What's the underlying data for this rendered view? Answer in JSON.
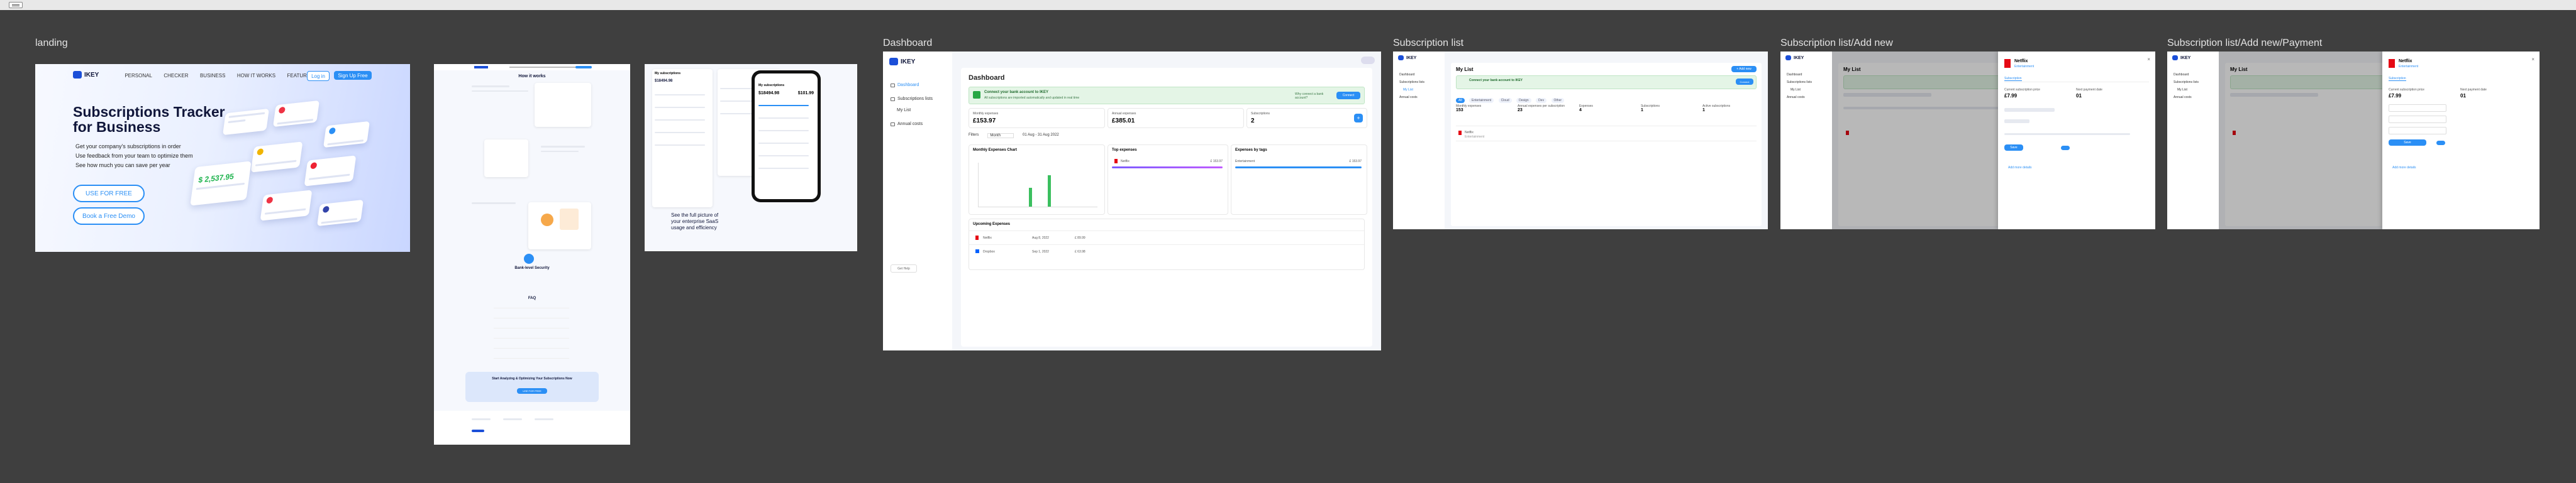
{
  "frames": {
    "landing": "landing",
    "dashboard": "Dashboard",
    "sub_list": "Subscription list",
    "sub_add": "Subscription list/Add new",
    "sub_add_payment": "Subscription list/Add new/Payment"
  },
  "landing": {
    "logo": "IKEY",
    "nav": [
      "PERSONAL",
      "CHECKER",
      "BUSINESS",
      "HOW IT WORKS",
      "FEATURES"
    ],
    "login": "Log in",
    "signup": "Sign Up Free",
    "title_line1": "Subscriptions Tracker",
    "title_line2": "for Business",
    "bullets": [
      "Get your company's subscriptions in order",
      "Use feedback from your team to optimize them",
      "See how much you can save per year"
    ],
    "cta_primary": "USE FOR FREE",
    "cta_secondary": "Book a Free Demo",
    "card_amount": "$ 2,537.95",
    "long_heading": "How it works",
    "long_security": "Bank-level Security",
    "long_faq": "FAQ",
    "long_cta": "Start Analyzing & Optimizing Your Subscriptions Now",
    "phone_title": "My subscriptions",
    "phone_amount_a": "$18494.98",
    "phone_amount_b": "$101.99",
    "phone_caption": "See the full picture of your enterprise SaaS usage and efficiency"
  },
  "dashboard": {
    "logo": "IKEY",
    "side": [
      "Dashboard",
      "Subscriptions lists",
      "My List",
      "Annual costs"
    ],
    "title": "Dashboard",
    "banner_title": "Connect your bank account to IKEY",
    "banner_sub": "All subscriptions are imported automatically and updated in real time",
    "banner_link": "Why connect a bank account?",
    "banner_btn": "Connect",
    "monthly_label": "Monthly expenses",
    "monthly_value": "£153.97",
    "annual_label": "Annual expenses",
    "annual_value": "£385.01",
    "subs_label": "Subscriptions",
    "subs_value": "2",
    "filter_filters": "Filters",
    "filter_period": "Month",
    "filter_date": "01 Aug - 31 Aug 2022",
    "chart_title": "Monthly Expenses Chart",
    "top_title": "Top expenses",
    "top_item": "Netflix",
    "top_value": "£ 153.97",
    "tags_title": "Expenses by tags",
    "tags_item": "Entertainment",
    "tags_value": "£ 153.97",
    "upcoming_title": "Upcoming Expenses",
    "upcoming": [
      {
        "name": "Netflix",
        "date": "Aug 8, 2022",
        "amount": "£ 89.99"
      },
      {
        "name": "Dropbox",
        "date": "Sep 1, 2022",
        "amount": "£ 63.98"
      }
    ],
    "help": "Get Help"
  },
  "sub_list": {
    "title": "My List",
    "add_btn": "+ Add new",
    "tabs": [
      "All",
      "Entertainment",
      "Cloud",
      "Design",
      "Dev",
      "Other"
    ],
    "stats": [
      "Monthly expenses",
      "Annual expenses per subscription",
      "Expenses",
      "Subscriptions",
      "Active subscriptions"
    ],
    "stat_values": [
      "153",
      "23",
      "4",
      "1",
      "1"
    ],
    "row_name": "Netflix",
    "row_tag": "Entertainment"
  },
  "drawer": {
    "name": "Netflix",
    "tag": "Entertainment",
    "tab": "Subscription",
    "price_label": "Current subscription price",
    "price_value": "£7.99",
    "next_label": "Next payment date",
    "next_value": "01",
    "save_btn": "Save",
    "link": "Add more details"
  }
}
